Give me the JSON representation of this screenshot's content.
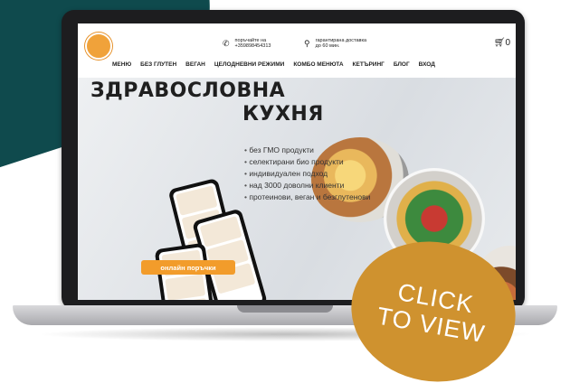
{
  "header": {
    "phone_text": "поръчайте на +359898454313",
    "delivery_text": "гарантирана доставка до 60 мин.",
    "cart_count": "0"
  },
  "nav": {
    "items": [
      {
        "label": "МЕНЮ"
      },
      {
        "label": "БЕЗ ГЛУТЕН"
      },
      {
        "label": "ВЕГАН"
      },
      {
        "label": "ЦЕЛОДНЕВНИ РЕЖИМИ"
      },
      {
        "label": "КОМБО МЕНЮТА"
      },
      {
        "label": "КЕТЪРИНГ"
      },
      {
        "label": "БЛОГ"
      },
      {
        "label": "ВХОД"
      }
    ]
  },
  "hero": {
    "title_line1": "ЗДРАВОСЛОВНА",
    "title_line2": "КУХНЯ",
    "bullets": [
      "без ГМО продукти",
      "селектирани био продукти",
      "индивидуален подход",
      "над 3000 доволни клиенти",
      "протеинови, веган и безглутенови"
    ],
    "cta_label": "онлайн поръчки"
  },
  "badge": {
    "line1": "CLICK",
    "line2": "TO VIEW"
  },
  "colors": {
    "teal": "#0f4a4d",
    "orange": "#f29c2b",
    "badge_gold": "#cf922f"
  },
  "icons": [
    "phone-icon",
    "location-pin-icon",
    "cart-icon"
  ]
}
